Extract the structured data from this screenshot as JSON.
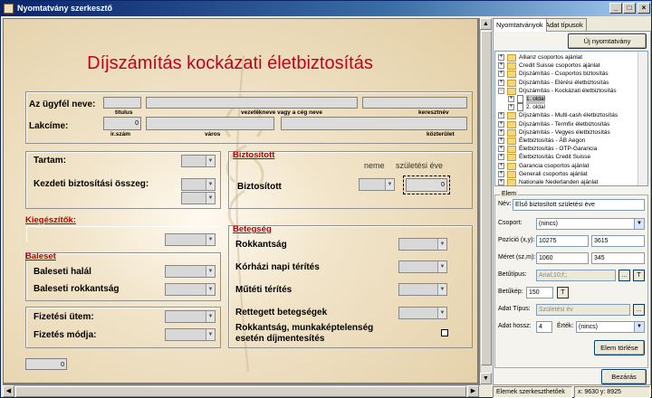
{
  "window": {
    "title": "Nyomtatvány szerkesztő",
    "min": "_",
    "max": "□",
    "close": "×"
  },
  "form": {
    "title": "Díjszámítás kockázati életbiztosítás",
    "client_name_label": "Az ügyfél neve:",
    "titulus": "titulus",
    "vezeteknev": "vezetékneve vagy a cég neve",
    "keresztnev": "keresztnév",
    "lakcim_label": "Lakcíme:",
    "irszam_value": "0",
    "irszam": "ir.szám",
    "varos": "város",
    "kozterulet": "közterület",
    "tartam": "Tartam:",
    "kezdeti": "Kezdeti biztosítási összeg:",
    "biztositott_section": "Biztosított",
    "neme": "neme",
    "szuletesi_eve": "születési éve",
    "biztositott_label": "Biztosított",
    "birth_value": "0",
    "kiegeszitok": "Kiegészítők:",
    "baleset": "Baleset",
    "baleseti_halal": "Baleseti halál",
    "baleseti_rokkantsag": "Baleseti rokkantság",
    "fizetesi_utem": "Fizetési ütem:",
    "fizetes_modja": "Fizetés módja:",
    "total_value": "0",
    "betegseg": "Betegség",
    "rokkantsag": "Rokkantság",
    "korhazi": "Kórházi napi térítés",
    "mutet": "Műtéti térítés",
    "rettegett": "Rettegett betegségek",
    "rokkantsag_munka_1": "Rokkantság, munkaképtelenség",
    "rokkantsag_munka_2": "esetén díjmentesítés"
  },
  "panel": {
    "tabs": [
      "Nyomtatványok",
      "Adat típusok"
    ],
    "new_button": "Új nyomtatvány",
    "tree": [
      {
        "label": "Allianz csoportos ajánlat",
        "expanded": false
      },
      {
        "label": "Credit Suisse csoportos ajánlat",
        "expanded": false
      },
      {
        "label": "Díjszámítás - Csoportos biztosítás",
        "expanded": false
      },
      {
        "label": "Díjszámítás - Elérési életbiztosítás",
        "expanded": false
      },
      {
        "label": "Díjszámítás - Kockázati életbiztosítás",
        "expanded": true
      },
      {
        "label": "1. oldal",
        "child": true,
        "selected": true
      },
      {
        "label": "2. oldal",
        "child": true
      },
      {
        "label": "Díjszámítás - Multi-cash életbiztosítás",
        "expanded": false
      },
      {
        "label": "Díjszámítás - Termfix életbiztosítás",
        "expanded": false
      },
      {
        "label": "Díjszámítás - Vegyes életbiztosítás",
        "expanded": false
      },
      {
        "label": "Életbiztosítás - ÁB Aegon",
        "expanded": false
      },
      {
        "label": "Életbiztosítás - OTP-Garancia",
        "expanded": false
      },
      {
        "label": "Életbiztosítás Credit Suisse",
        "expanded": false
      },
      {
        "label": "Garancia csoportos ajánlat",
        "expanded": false
      },
      {
        "label": "Generali csoportos ajánlat",
        "expanded": false
      },
      {
        "label": "Nationale Nederlanden ajánlat",
        "expanded": false
      }
    ],
    "elem_legend": "Elem",
    "nev_label": "Név:",
    "nev_value": "Első biztosított születési éve",
    "csoport_label": "Csoport:",
    "csoport_value": "(nincs)",
    "pozicio_label": "Pozíció (x,y):",
    "pozicio_x": "10275",
    "pozicio_y": "3615",
    "meret_label": "Méret (sz,m):",
    "meret_w": "1060",
    "meret_h": "345",
    "betutipus_label": "Betűtípus:",
    "betutipus_value": "Arial;10;f;;",
    "betutipus_btn1": "...",
    "betutipus_btn2": "T",
    "betukep_label": "Betűkép:",
    "betukep_value": "150",
    "betukep_btn": "T",
    "adattipus_label": "Adat Típus:",
    "adattipus_value": "Születési év",
    "adattipus_btn": "...",
    "adathossz_label": "Adat hossz:",
    "adathossz_value": "4",
    "ertek_label": "Érték:",
    "ertek_value": "(nincs)",
    "delete_button": "Elem törlése",
    "close_button": "Bezárás"
  },
  "status": {
    "left": "Elemek szerkeszthetőek",
    "coords": "x: 9630 y: 8925"
  }
}
